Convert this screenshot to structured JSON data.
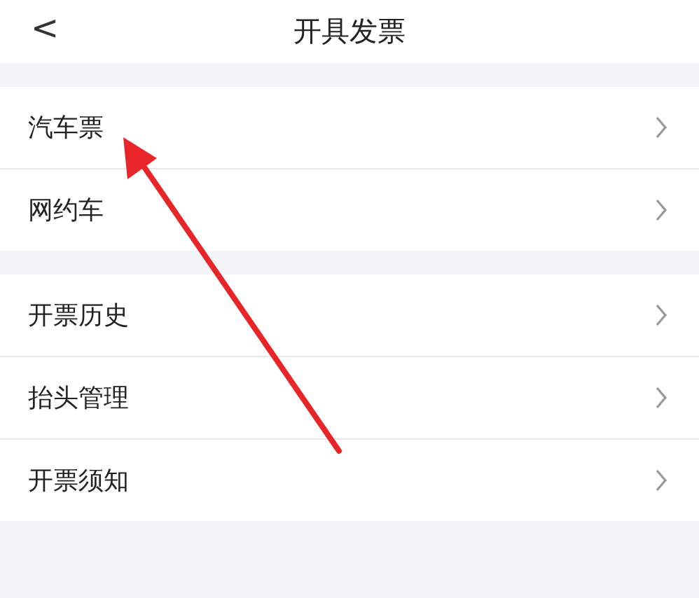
{
  "header": {
    "back": "<",
    "title": "开具发票"
  },
  "groups": [
    {
      "items": [
        {
          "label": "汽车票"
        },
        {
          "label": "网约车"
        }
      ]
    },
    {
      "items": [
        {
          "label": "开票历史"
        },
        {
          "label": "抬头管理"
        },
        {
          "label": "开票须知"
        }
      ]
    }
  ]
}
